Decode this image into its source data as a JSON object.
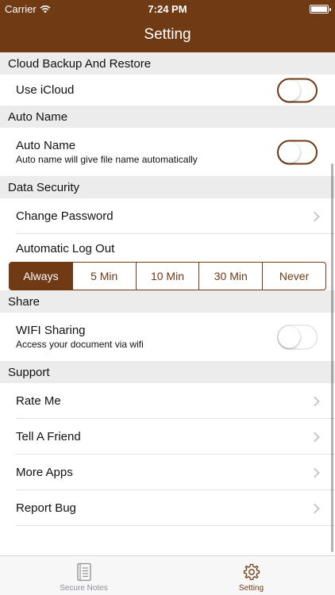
{
  "status_bar": {
    "carrier": "Carrier",
    "time": "7:24 PM"
  },
  "nav": {
    "title": "Setting"
  },
  "colors": {
    "brand": "#6f3a14",
    "section_bg": "#ececec",
    "chevron": "#c7c7cc"
  },
  "sections": {
    "cloud": {
      "header": "Cloud Backup And Restore",
      "use_icloud": {
        "label": "Use  iCloud",
        "on": true
      }
    },
    "autoname": {
      "header": "Auto Name",
      "row": {
        "label": "Auto Name",
        "subtitle": "Auto name will give file name automatically",
        "on": true
      }
    },
    "security": {
      "header": "Data Security",
      "change_password": "Change Password",
      "auto_logout_label": "Automatic Log Out",
      "options": [
        "Always",
        "5 Min",
        "10 Min",
        "30 Min",
        "Never"
      ],
      "selected": "Always"
    },
    "share": {
      "header": "Share",
      "wifi": {
        "label": "WIFI Sharing",
        "subtitle": "Access your document via wifi",
        "on": false
      }
    },
    "support": {
      "header": "Support",
      "items": [
        "Rate Me",
        "Tell A Friend",
        "More Apps",
        "Report Bug"
      ]
    }
  },
  "tabbar": {
    "tabs": [
      "Secure Notes",
      "Setting"
    ],
    "active": "Setting"
  },
  "icons": {
    "wifi": "wifi-icon",
    "battery": "battery-icon",
    "secure_notes": "notebook-icon",
    "setting": "gear-icon",
    "chevron": "chevron-right-icon"
  }
}
